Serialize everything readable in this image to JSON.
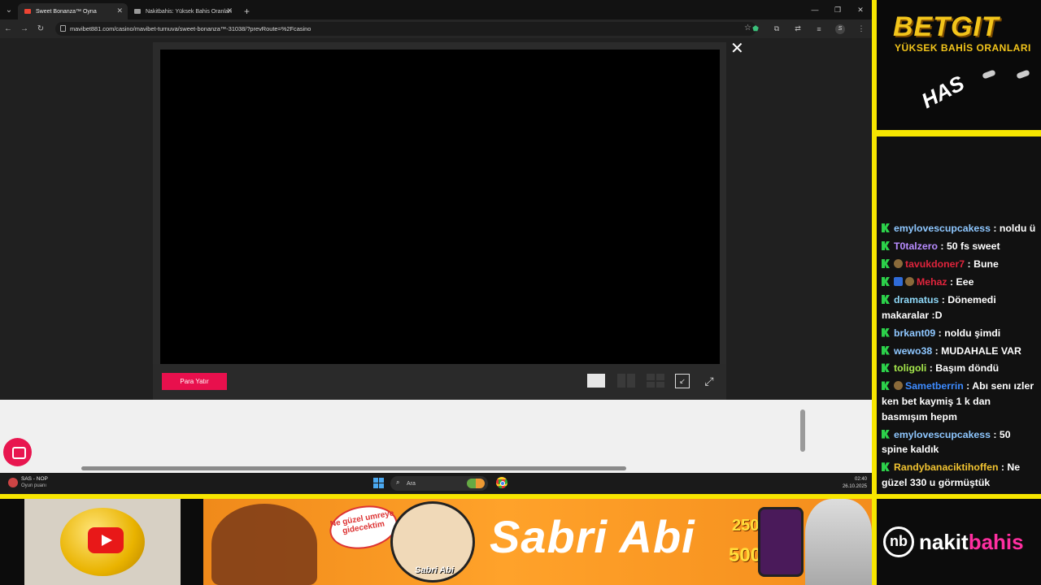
{
  "browser": {
    "tabs": [
      {
        "title": "Sweet Bonanza™ Oyna",
        "active": true
      },
      {
        "title": "Nakitbahis: Yüksek Bahis Oranları",
        "active": false
      }
    ],
    "url": "mavibet881.com/casino/mavibet-turnuva/sweet-bonanza™-31038/?prevRoute=%2Fcasino",
    "window_controls": [
      "minimize-icon",
      "maximize-icon",
      "close-icon"
    ]
  },
  "game_modal": {
    "deposit_label": "Para Yatır",
    "close_glyph": "✕",
    "controls": [
      "single-view-icon",
      "split-view-icon",
      "quad-view-icon",
      "minimize-window-icon",
      "fullscreen-icon"
    ]
  },
  "taskbar": {
    "weather_title": "SAS - NOP",
    "weather_sub": "Oyun puanı",
    "search_placeholder": "Ara",
    "time": "02:40",
    "date": "26.10.2025"
  },
  "overlay": {
    "brand_title": "BETGIT",
    "brand_sub": "YÜKSEK BAHİS ORANLARI",
    "has_logo": "HAS",
    "banner_bubble": "Ne güzel umreye gidecektim",
    "banner_portrait_caption": "Sabri Abi",
    "banner_title": "Sabri Abi",
    "banner_num_1": "250",
    "banner_num_2": "500x",
    "sponsor_mark": "nb",
    "sponsor_a": "nakit",
    "sponsor_b": "bahis",
    "accent": "#f7e600"
  },
  "chat": [
    {
      "user": "emylovescupcakess",
      "text": "noldu ü",
      "color": "#8ec7ff",
      "badges": []
    },
    {
      "user": "T0talzero",
      "text": "50 fs sweet",
      "color": "#b88cff",
      "badges": []
    },
    {
      "user": "tavukdoner7",
      "text": "Bune",
      "color": "#e0243c",
      "badges": [
        "coin"
      ]
    },
    {
      "user": "Mehaz",
      "text": "Eee",
      "color": "#e0243c",
      "badges": [
        "blue",
        "coin"
      ]
    },
    {
      "user": "dramatus",
      "text": "Dönemedi makaralar :D",
      "color": "#8ed8f8",
      "badges": []
    },
    {
      "user": "brkant09",
      "text": "noldu şimdi",
      "color": "#8ec7ff",
      "badges": []
    },
    {
      "user": "wewo38",
      "text": "MUDAHALE VAR",
      "color": "#8ec7ff",
      "badges": []
    },
    {
      "user": "toligoli",
      "text": "Başım döndü",
      "color": "#a6e84c",
      "badges": []
    },
    {
      "user": "Sametberrin",
      "text": "Abı senı ızler ken bet kaymiş 1 k dan basmışım hepm",
      "color": "#3d8bff",
      "badges": [
        "coin"
      ]
    },
    {
      "user": "emylovescupcakess",
      "text": "50 spine kaldık",
      "color": "#8ec7ff",
      "badges": []
    },
    {
      "user": "Randybanaciktihoffen",
      "text": "Ne güzel 330 u görmüştük",
      "color": "#f2c431",
      "badges": []
    }
  ]
}
